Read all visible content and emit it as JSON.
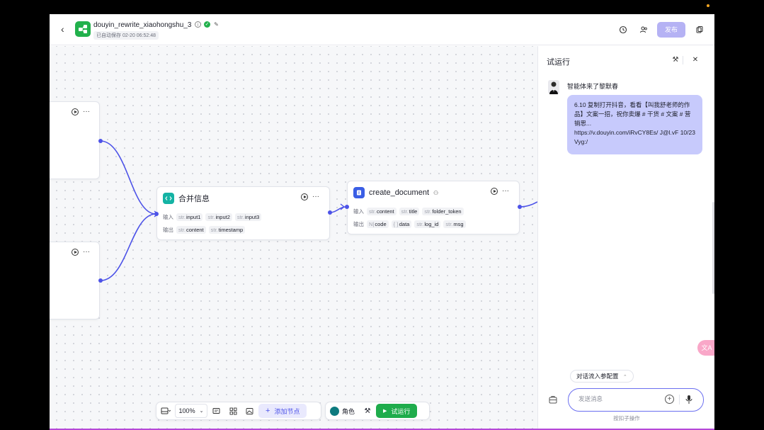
{
  "header": {
    "title": "douyin_rewrite_xiaohongshu_3",
    "saved_text": "已自动保存 02-20 06:52:48",
    "publish_label": "发布"
  },
  "nodes": {
    "left_top": {},
    "left_bottom": {},
    "merge": {
      "title": "合并信息",
      "input_label": "输入",
      "output_label": "输出",
      "inputs": [
        "input1",
        "input2",
        "input3"
      ],
      "outputs": [
        "content",
        "timestamp"
      ],
      "type_prefix": "str."
    },
    "create_doc": {
      "title": "create_document",
      "input_label": "输入",
      "output_label": "输出",
      "inputs": [
        "content",
        "title",
        "folder_token"
      ],
      "outputs": [
        {
          "type": "N|",
          "name": "code"
        },
        {
          "type": "{ }",
          "name": "data"
        },
        {
          "type": "str.",
          "name": "log_id"
        },
        {
          "type": "str.",
          "name": "msg"
        }
      ],
      "type_prefix": "str."
    }
  },
  "toolbar": {
    "zoom": "100%",
    "add_node": "添加节点",
    "role": "角色",
    "run": "试运行"
  },
  "panel": {
    "title": "试运行",
    "bot_name": "智能体来了黎默春",
    "message": "6.10 复制打开抖音，看看【叫我舒老师的作品】文案一招，祝你卖爆 # 干货 # 文案 # 营销思...\nhttps://v.douyin.com/iRvCY8Es/ J@l.vF 10/23 Vyg:/",
    "config_chip": "对话流入参配置",
    "input_placeholder": "发送消息",
    "hint": "按扣子操作"
  },
  "colors": {
    "accent": "#4d53e8",
    "run_green": "#1fac4c",
    "bubble": "#c7cafc",
    "publish": "#b5b2f4"
  }
}
